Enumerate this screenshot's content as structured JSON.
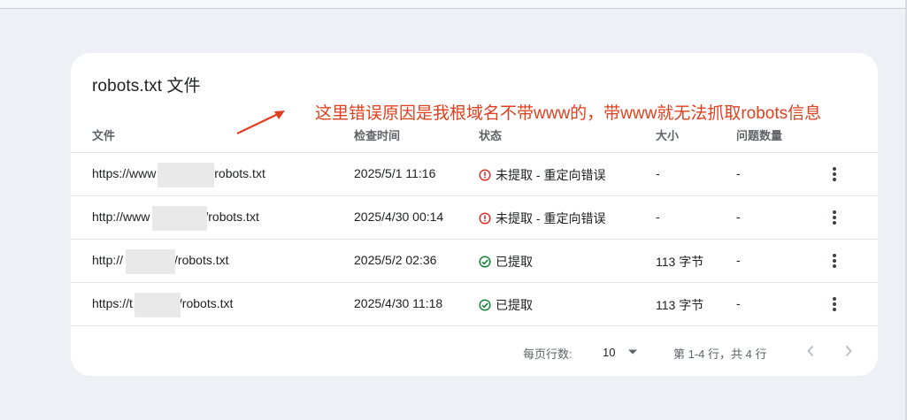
{
  "card": {
    "title": "robots.txt 文件",
    "annotation": "这里错误原因是我根域名不带www的，带www就无法抓取robots信息"
  },
  "table": {
    "headers": {
      "file": "文件",
      "checked": "检查时间",
      "status": "状态",
      "size": "大小",
      "issues": "问题数量"
    },
    "rows": [
      {
        "url_prefix": "https://www",
        "url_suffix": "/robots.txt",
        "checked": "2025/5/1 11:16",
        "status": "未提取 - 重定向错误",
        "status_kind": "error",
        "size": "-",
        "issues": "-"
      },
      {
        "url_prefix": "http://www",
        "url_suffix": "/robots.txt",
        "checked": "2025/4/30 00:14",
        "status": "未提取 - 重定向错误",
        "status_kind": "error",
        "size": "-",
        "issues": "-"
      },
      {
        "url_prefix": "http://",
        "url_suffix": "/robots.txt",
        "checked": "2025/5/2 02:36",
        "status": "已提取",
        "status_kind": "ok",
        "size": "113 字节",
        "issues": "-"
      },
      {
        "url_prefix": "https://t",
        "url_suffix": "/robots.txt",
        "checked": "2025/4/30 11:18",
        "status": "已提取",
        "status_kind": "ok",
        "size": "113 字节",
        "issues": "-"
      }
    ]
  },
  "pagination": {
    "rows_per_page_label": "每页行数:",
    "rows_per_page_value": "10",
    "range_text": "第 1-4 行，共 4 行"
  },
  "colors": {
    "error": "#d93025",
    "ok": "#188038",
    "annotation": "#e0401f"
  },
  "icons": {
    "error": "error-circle-icon",
    "ok": "check-circle-icon",
    "more": "more-vert-icon",
    "dropdown": "arrow-drop-down-icon",
    "prev": "chevron-left-icon",
    "next": "chevron-right-icon"
  }
}
